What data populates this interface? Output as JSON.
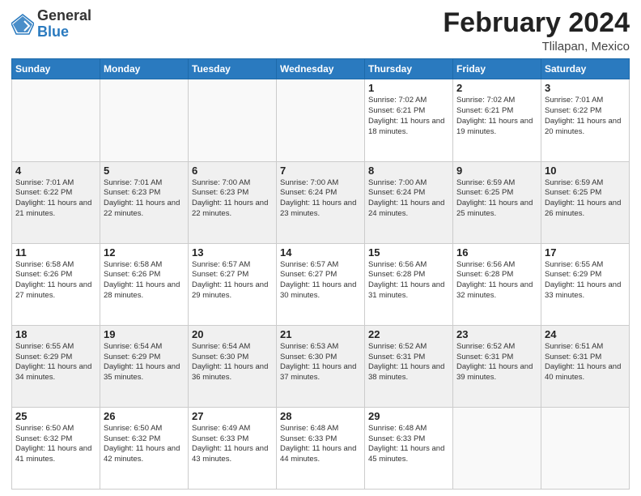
{
  "header": {
    "logo_general": "General",
    "logo_blue": "Blue",
    "title": "February 2024",
    "location": "Tlilapan, Mexico"
  },
  "weekdays": [
    "Sunday",
    "Monday",
    "Tuesday",
    "Wednesday",
    "Thursday",
    "Friday",
    "Saturday"
  ],
  "weeks": [
    [
      {
        "day": "",
        "info": ""
      },
      {
        "day": "",
        "info": ""
      },
      {
        "day": "",
        "info": ""
      },
      {
        "day": "",
        "info": ""
      },
      {
        "day": "1",
        "info": "Sunrise: 7:02 AM\nSunset: 6:21 PM\nDaylight: 11 hours and 18 minutes."
      },
      {
        "day": "2",
        "info": "Sunrise: 7:02 AM\nSunset: 6:21 PM\nDaylight: 11 hours and 19 minutes."
      },
      {
        "day": "3",
        "info": "Sunrise: 7:01 AM\nSunset: 6:22 PM\nDaylight: 11 hours and 20 minutes."
      }
    ],
    [
      {
        "day": "4",
        "info": "Sunrise: 7:01 AM\nSunset: 6:22 PM\nDaylight: 11 hours and 21 minutes."
      },
      {
        "day": "5",
        "info": "Sunrise: 7:01 AM\nSunset: 6:23 PM\nDaylight: 11 hours and 22 minutes."
      },
      {
        "day": "6",
        "info": "Sunrise: 7:00 AM\nSunset: 6:23 PM\nDaylight: 11 hours and 22 minutes."
      },
      {
        "day": "7",
        "info": "Sunrise: 7:00 AM\nSunset: 6:24 PM\nDaylight: 11 hours and 23 minutes."
      },
      {
        "day": "8",
        "info": "Sunrise: 7:00 AM\nSunset: 6:24 PM\nDaylight: 11 hours and 24 minutes."
      },
      {
        "day": "9",
        "info": "Sunrise: 6:59 AM\nSunset: 6:25 PM\nDaylight: 11 hours and 25 minutes."
      },
      {
        "day": "10",
        "info": "Sunrise: 6:59 AM\nSunset: 6:25 PM\nDaylight: 11 hours and 26 minutes."
      }
    ],
    [
      {
        "day": "11",
        "info": "Sunrise: 6:58 AM\nSunset: 6:26 PM\nDaylight: 11 hours and 27 minutes."
      },
      {
        "day": "12",
        "info": "Sunrise: 6:58 AM\nSunset: 6:26 PM\nDaylight: 11 hours and 28 minutes."
      },
      {
        "day": "13",
        "info": "Sunrise: 6:57 AM\nSunset: 6:27 PM\nDaylight: 11 hours and 29 minutes."
      },
      {
        "day": "14",
        "info": "Sunrise: 6:57 AM\nSunset: 6:27 PM\nDaylight: 11 hours and 30 minutes."
      },
      {
        "day": "15",
        "info": "Sunrise: 6:56 AM\nSunset: 6:28 PM\nDaylight: 11 hours and 31 minutes."
      },
      {
        "day": "16",
        "info": "Sunrise: 6:56 AM\nSunset: 6:28 PM\nDaylight: 11 hours and 32 minutes."
      },
      {
        "day": "17",
        "info": "Sunrise: 6:55 AM\nSunset: 6:29 PM\nDaylight: 11 hours and 33 minutes."
      }
    ],
    [
      {
        "day": "18",
        "info": "Sunrise: 6:55 AM\nSunset: 6:29 PM\nDaylight: 11 hours and 34 minutes."
      },
      {
        "day": "19",
        "info": "Sunrise: 6:54 AM\nSunset: 6:29 PM\nDaylight: 11 hours and 35 minutes."
      },
      {
        "day": "20",
        "info": "Sunrise: 6:54 AM\nSunset: 6:30 PM\nDaylight: 11 hours and 36 minutes."
      },
      {
        "day": "21",
        "info": "Sunrise: 6:53 AM\nSunset: 6:30 PM\nDaylight: 11 hours and 37 minutes."
      },
      {
        "day": "22",
        "info": "Sunrise: 6:52 AM\nSunset: 6:31 PM\nDaylight: 11 hours and 38 minutes."
      },
      {
        "day": "23",
        "info": "Sunrise: 6:52 AM\nSunset: 6:31 PM\nDaylight: 11 hours and 39 minutes."
      },
      {
        "day": "24",
        "info": "Sunrise: 6:51 AM\nSunset: 6:31 PM\nDaylight: 11 hours and 40 minutes."
      }
    ],
    [
      {
        "day": "25",
        "info": "Sunrise: 6:50 AM\nSunset: 6:32 PM\nDaylight: 11 hours and 41 minutes."
      },
      {
        "day": "26",
        "info": "Sunrise: 6:50 AM\nSunset: 6:32 PM\nDaylight: 11 hours and 42 minutes."
      },
      {
        "day": "27",
        "info": "Sunrise: 6:49 AM\nSunset: 6:33 PM\nDaylight: 11 hours and 43 minutes."
      },
      {
        "day": "28",
        "info": "Sunrise: 6:48 AM\nSunset: 6:33 PM\nDaylight: 11 hours and 44 minutes."
      },
      {
        "day": "29",
        "info": "Sunrise: 6:48 AM\nSunset: 6:33 PM\nDaylight: 11 hours and 45 minutes."
      },
      {
        "day": "",
        "info": ""
      },
      {
        "day": "",
        "info": ""
      }
    ]
  ]
}
